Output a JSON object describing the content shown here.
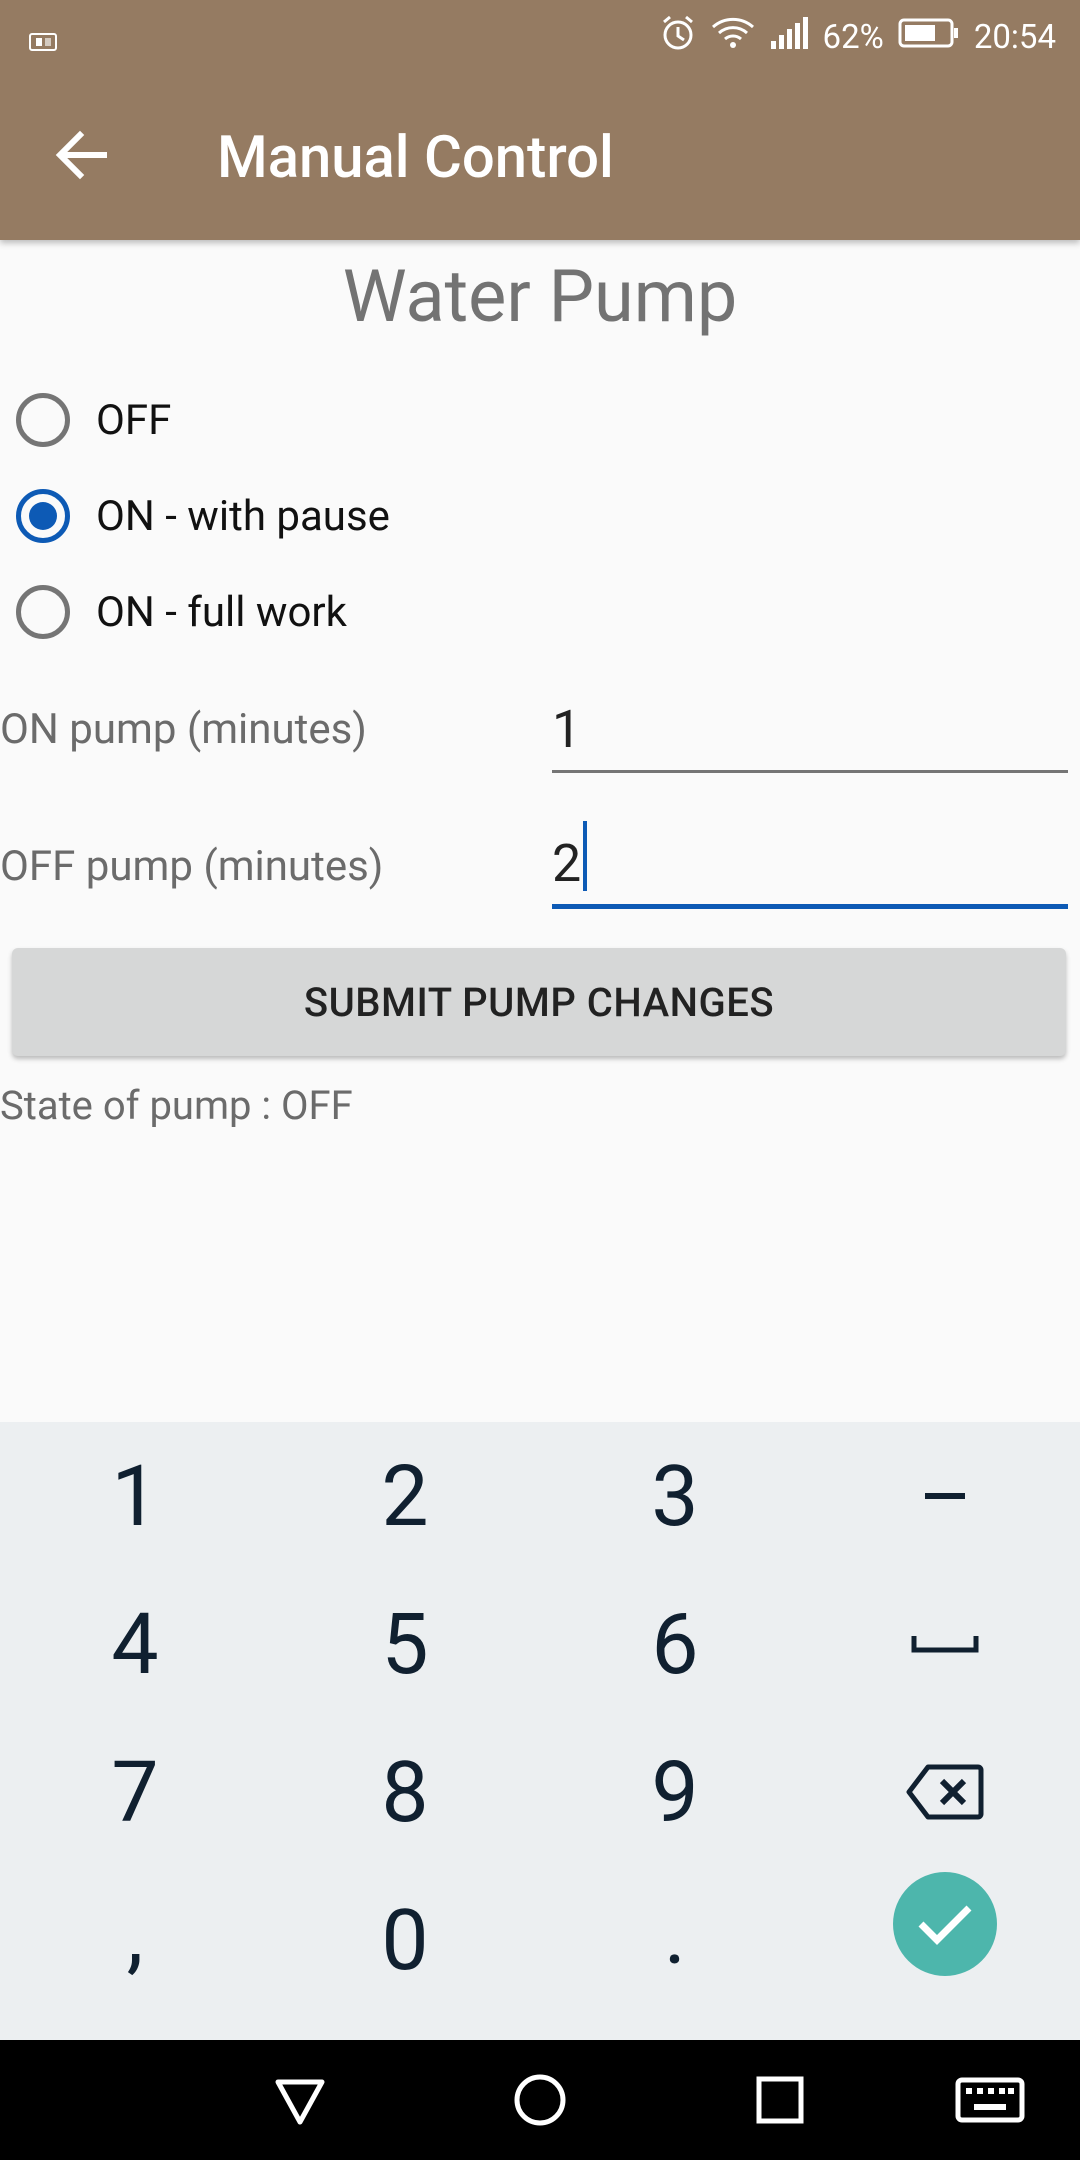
{
  "status_bar": {
    "battery": "62%",
    "time": "20:54"
  },
  "app_bar": {
    "title": "Manual Control"
  },
  "section": {
    "title": "Water Pump"
  },
  "radio_options": [
    {
      "label": "OFF",
      "checked": false
    },
    {
      "label": "ON - with pause",
      "checked": true
    },
    {
      "label": "ON - full work",
      "checked": false
    }
  ],
  "fields": {
    "on_label": "ON pump (minutes)",
    "on_value": "1",
    "off_label": "OFF pump (minutes)",
    "off_value": "2"
  },
  "submit_label": "SUBMIT PUMP CHANGES",
  "state_text": "State of pump : OFF",
  "keyboard": {
    "keys": [
      "1",
      "2",
      "3",
      "–",
      "4",
      "5",
      "6",
      "␣",
      "7",
      "8",
      "9",
      "⌫",
      ",",
      "0",
      ".",
      "✓"
    ]
  },
  "colors": {
    "app_bar": "#957b62",
    "accent": "#0d5ab5",
    "enter_key": "#4db6ac"
  }
}
